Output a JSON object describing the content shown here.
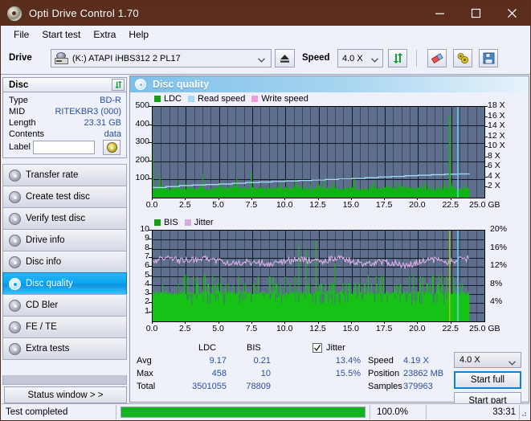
{
  "window": {
    "title": "Opti Drive Control 1.70",
    "app_icon": "disc-icon",
    "minimize": "minimize-icon",
    "maximize": "maximize-icon",
    "close": "close-icon"
  },
  "menu": {
    "items": [
      {
        "label": "File"
      },
      {
        "label": "Start test"
      },
      {
        "label": "Extra"
      },
      {
        "label": "Help"
      }
    ]
  },
  "toolbar": {
    "drive_label": "Drive",
    "drive_value": "(K:)  ATAPI iHBS312  2 PL17",
    "eject": "eject-icon",
    "speed_label": "Speed",
    "speed_value": "4.0 X",
    "refresh": "refresh-icon",
    "erase": "eraser-icon",
    "tools": "tools-icon",
    "save": "save-icon"
  },
  "disc_panel": {
    "header": "Disc",
    "refresh": "refresh-icon",
    "rows": [
      {
        "key": "Type",
        "value": "BD-R"
      },
      {
        "key": "MID",
        "value": "RITEKBR3 (000)"
      },
      {
        "key": "Length",
        "value": "23.31 GB"
      },
      {
        "key": "Contents",
        "value": "data"
      }
    ],
    "label_key": "Label",
    "label_value": "",
    "label_button_icon": "cd-icon"
  },
  "sidebar": {
    "items": [
      {
        "label": "Transfer rate",
        "icon": "disc-icon",
        "active": false
      },
      {
        "label": "Create test disc",
        "icon": "disc-icon",
        "active": false
      },
      {
        "label": "Verify test disc",
        "icon": "disc-icon",
        "active": false
      },
      {
        "label": "Drive info",
        "icon": "disc-icon",
        "active": false
      },
      {
        "label": "Disc info",
        "icon": "disc-icon",
        "active": false
      },
      {
        "label": "Disc quality",
        "icon": "disc-icon",
        "active": true
      },
      {
        "label": "CD Bler",
        "icon": "disc-icon",
        "active": false
      },
      {
        "label": "FE / TE",
        "icon": "disc-icon",
        "active": false
      },
      {
        "label": "Extra tests",
        "icon": "disc-icon",
        "active": false
      }
    ],
    "status_window_button": "Status window > >"
  },
  "content": {
    "header": "Disc quality",
    "header_icon": "disc-icon"
  },
  "chart_data": [
    {
      "id": "ldc-chart",
      "type": "area",
      "title": "",
      "xlabel": "GB",
      "ylabel": "LDC",
      "legend": [
        {
          "name": "LDC",
          "color": "#12a012"
        },
        {
          "name": "Read speed",
          "color": "#a6d9f5"
        },
        {
          "name": "Write speed",
          "color": "#f49ae0"
        }
      ],
      "legend_position": "top-left",
      "grid": true,
      "xlim": [
        0.0,
        25.0
      ],
      "xticks": [
        "0.0",
        "2.5",
        "5.0",
        "7.5",
        "10.0",
        "12.5",
        "15.0",
        "17.5",
        "20.0",
        "22.5",
        "25.0 GB"
      ],
      "ylim": [
        0,
        500
      ],
      "yticks": [
        "100",
        "200",
        "300",
        "400",
        "500"
      ],
      "y2lim": [
        0,
        18
      ],
      "y2ticks": [
        "2 X",
        "4 X",
        "6 X",
        "8 X",
        "10 X",
        "12 X",
        "14 X",
        "16 X",
        "18 X"
      ],
      "series": [
        {
          "name": "LDC",
          "color": "#12a012",
          "x": [
            0.0,
            0.15,
            0.3,
            0.45,
            0.6,
            0.75,
            0.9,
            1.1,
            1.3,
            1.5,
            1.7,
            1.9,
            2.1,
            2.3,
            2.6,
            2.9,
            3.2,
            3.5,
            3.8,
            4.1,
            4.4,
            4.7,
            5.0,
            5.3,
            5.6,
            5.9,
            6.2,
            6.5,
            6.8,
            7.1,
            7.4,
            7.7,
            8.0,
            8.3,
            8.6,
            8.9,
            9.2,
            9.5,
            9.8,
            10.1,
            10.4,
            10.7,
            11.0,
            11.3,
            11.6,
            11.9,
            12.2,
            12.5,
            12.8,
            13.1,
            13.4,
            13.7,
            14.0,
            14.3,
            14.6,
            14.9,
            15.2,
            15.5,
            15.8,
            16.1,
            16.4,
            16.7,
            17.0,
            17.3,
            17.6,
            17.9,
            18.2,
            18.5,
            18.8,
            19.1,
            19.4,
            19.7,
            20.0,
            20.3,
            20.6,
            20.9,
            21.2,
            21.5,
            21.8,
            22.1,
            22.4,
            22.5,
            22.7,
            23.0,
            23.3,
            23.6,
            23.86
          ],
          "values": [
            300,
            55,
            48,
            44,
            130,
            52,
            46,
            42,
            40,
            45,
            38,
            42,
            40,
            44,
            38,
            42,
            36,
            40,
            130,
            44,
            38,
            42,
            40,
            36,
            44,
            38,
            42,
            40,
            36,
            44,
            150,
            40,
            38,
            42,
            36,
            40,
            44,
            38,
            42,
            40,
            36,
            44,
            38,
            42,
            40,
            44,
            38,
            42,
            36,
            40,
            44,
            38,
            42,
            40,
            36,
            44,
            120,
            40,
            38,
            42,
            36,
            40,
            44,
            38,
            42,
            36,
            40,
            44,
            38,
            42,
            40,
            36,
            44,
            38,
            42,
            40,
            44,
            38,
            42,
            40,
            450,
            40,
            38,
            42,
            40,
            36,
            44
          ]
        },
        {
          "name": "Read speed",
          "color": "#a6d9f5",
          "x": [
            0.0,
            1.0,
            2.0,
            3.0,
            4.0,
            5.0,
            6.0,
            7.0,
            8.0,
            9.0,
            10.0,
            11.0,
            12.0,
            13.0,
            14.0,
            15.0,
            16.0,
            17.0,
            18.0,
            19.0,
            20.0,
            21.0,
            22.0,
            23.0,
            23.86
          ],
          "values": [
            2.0,
            2.2,
            2.4,
            2.5,
            2.6,
            2.7,
            2.85,
            3.0,
            3.1,
            3.2,
            3.3,
            3.4,
            3.5,
            3.6,
            3.7,
            3.8,
            3.95,
            4.1,
            4.2,
            4.35,
            4.45,
            4.55,
            4.65,
            4.7,
            4.75
          ]
        }
      ],
      "markers": [
        {
          "name": "end-of-test",
          "x": 23.0,
          "color": "#5ad0f7"
        }
      ]
    },
    {
      "id": "bis-chart",
      "type": "area",
      "title": "",
      "xlabel": "GB",
      "ylabel": "BIS",
      "legend": [
        {
          "name": "BIS",
          "color": "#12a012"
        },
        {
          "name": "Jitter",
          "color": "#d9a8e0"
        }
      ],
      "legend_position": "top-left",
      "grid": true,
      "xlim": [
        0.0,
        25.0
      ],
      "xticks": [
        "0.0",
        "2.5",
        "5.0",
        "7.5",
        "10.0",
        "12.5",
        "15.0",
        "17.5",
        "20.0",
        "22.5",
        "25.0 GB"
      ],
      "ylim": [
        0,
        10
      ],
      "yticks": [
        "1",
        "2",
        "3",
        "4",
        "5",
        "6",
        "7",
        "8",
        "9",
        "10"
      ],
      "y2lim": [
        0,
        20
      ],
      "y2ticks": [
        "4%",
        "8%",
        "12%",
        "16%",
        "20%"
      ],
      "series": [
        {
          "name": "BIS",
          "color": "#12a012",
          "avg": 0.21,
          "max": 10,
          "total": 78809
        },
        {
          "name": "Jitter",
          "color": "#d9a8e0",
          "avg": 13.4,
          "max": 15.5
        }
      ],
      "markers": [
        {
          "name": "end-of-test",
          "x": 23.0,
          "color": "#5ad0f7"
        }
      ]
    }
  ],
  "stats": {
    "col_headers": [
      "LDC",
      "BIS"
    ],
    "rows": [
      {
        "label": "Avg",
        "ldc": "9.17",
        "bis": "0.21"
      },
      {
        "label": "Max",
        "ldc": "458",
        "bis": "10"
      },
      {
        "label": "Total",
        "ldc": "3501055",
        "bis": "78809"
      }
    ],
    "jitter": {
      "checked": true,
      "label": "Jitter",
      "avg": "13.4%",
      "max": "15.5%"
    },
    "right": [
      {
        "label": "Speed",
        "value": "4.19 X"
      },
      {
        "label": "Position",
        "value": "23862 MB"
      },
      {
        "label": "Samples",
        "value": "379963"
      }
    ],
    "speed_select": "4.0 X",
    "start_full": "Start full",
    "start_part": "Start part"
  },
  "statusbar": {
    "message": "Test completed",
    "progress_percent": 100.0,
    "progress_text": "100.0%",
    "elapsed": "33:31"
  },
  "colors": {
    "title_bar": "#5b2d1d",
    "accent": "#0aa7ef",
    "value_text": "#2b4ea2",
    "plot_bg": "#5e6f8e",
    "ldc_green": "#12a012",
    "read_speed": "#a6d9f5",
    "write_speed": "#f49ae0",
    "jitter": "#d9a8e0",
    "progress_green": "#12b520"
  }
}
